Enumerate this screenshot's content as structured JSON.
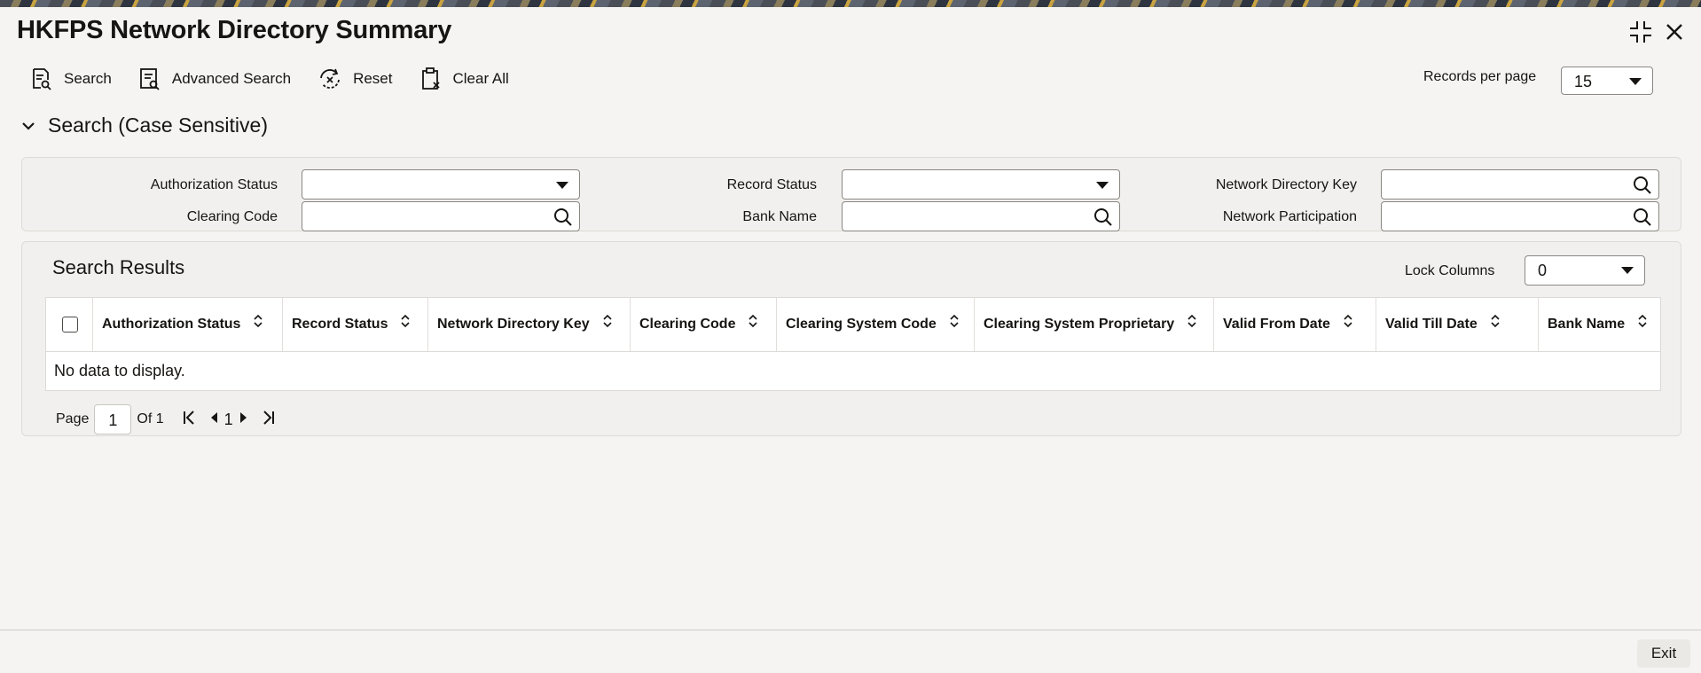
{
  "window": {
    "title": "HKFPS Network Directory Summary"
  },
  "toolbar": {
    "search_label": "Search",
    "advanced_search_label": "Advanced Search",
    "reset_label": "Reset",
    "clear_all_label": "Clear All",
    "records_per_page_label": "Records per page",
    "records_per_page_value": "15"
  },
  "search_section": {
    "title": "Search (Case Sensitive)",
    "fields": {
      "authorization_status": {
        "label": "Authorization Status",
        "value": ""
      },
      "record_status": {
        "label": "Record Status",
        "value": ""
      },
      "network_directory_key": {
        "label": "Network Directory Key",
        "value": ""
      },
      "clearing_code": {
        "label": "Clearing Code",
        "value": ""
      },
      "bank_name": {
        "label": "Bank Name",
        "value": ""
      },
      "network_participation": {
        "label": "Network Participation",
        "value": ""
      }
    }
  },
  "results": {
    "title": "Search Results",
    "lock_columns_label": "Lock Columns",
    "lock_columns_value": "0",
    "columns": [
      "Authorization Status",
      "Record Status",
      "Network Directory Key",
      "Clearing Code",
      "Clearing System Code",
      "Clearing System Proprietary",
      "Valid From Date",
      "Valid Till Date",
      "Bank Name"
    ],
    "empty_message": "No data to display."
  },
  "pagination": {
    "page_label": "Page",
    "current_page": "1",
    "of_label": "Of 1",
    "page_number": "1"
  },
  "footer": {
    "exit_label": "Exit"
  }
}
